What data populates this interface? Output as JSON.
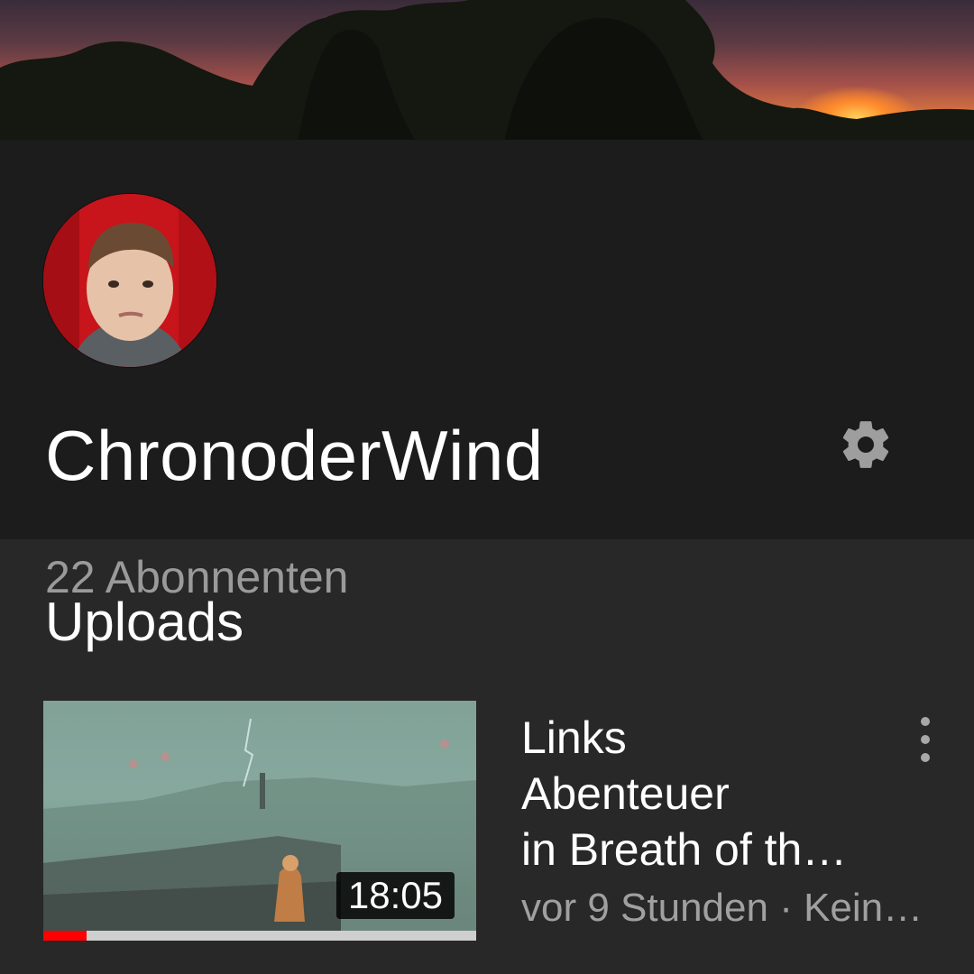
{
  "channel": {
    "name": "ChronoderWind",
    "subscribers": "22 Abonnenten"
  },
  "icons": {
    "settings": "gear-icon",
    "more": "more-vert-icon"
  },
  "uploads": {
    "title": "Uploads",
    "videos": [
      {
        "title_lines": [
          "Links",
          "Abenteuer",
          "in Breath of th…"
        ],
        "meta": "vor 9 Stunden · Kein…",
        "duration": "18:05",
        "watched_fraction": 0.1
      }
    ]
  },
  "colors": {
    "background": "#282828",
    "header_background": "#1c1c1c",
    "progress": "#ff0000",
    "secondary_text": "#9a9a9a"
  }
}
